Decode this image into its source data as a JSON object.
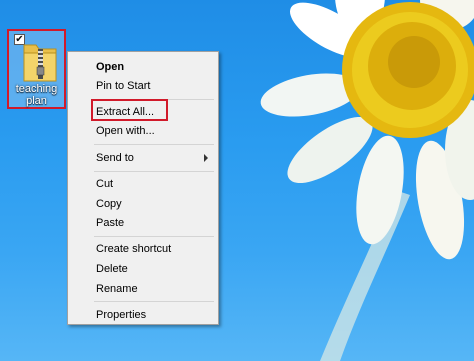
{
  "desktop": {
    "icon": {
      "label_line1": "teaching",
      "label_line2": "plan",
      "checked_mark": "✔",
      "icon_name": "zip-folder-icon"
    }
  },
  "context_menu": {
    "items": [
      {
        "label": "Open"
      },
      {
        "label": "Pin to Start"
      },
      {
        "label": "Extract All..."
      },
      {
        "label": "Open with..."
      },
      {
        "label": "Send to"
      },
      {
        "label": "Cut"
      },
      {
        "label": "Copy"
      },
      {
        "label": "Paste"
      },
      {
        "label": "Create shortcut"
      },
      {
        "label": "Delete"
      },
      {
        "label": "Rename"
      },
      {
        "label": "Properties"
      }
    ]
  },
  "colors": {
    "highlight_border": "#d11a2a",
    "menu_bg": "#f0f0f0",
    "desktop_blue": "#2a9cf0"
  }
}
